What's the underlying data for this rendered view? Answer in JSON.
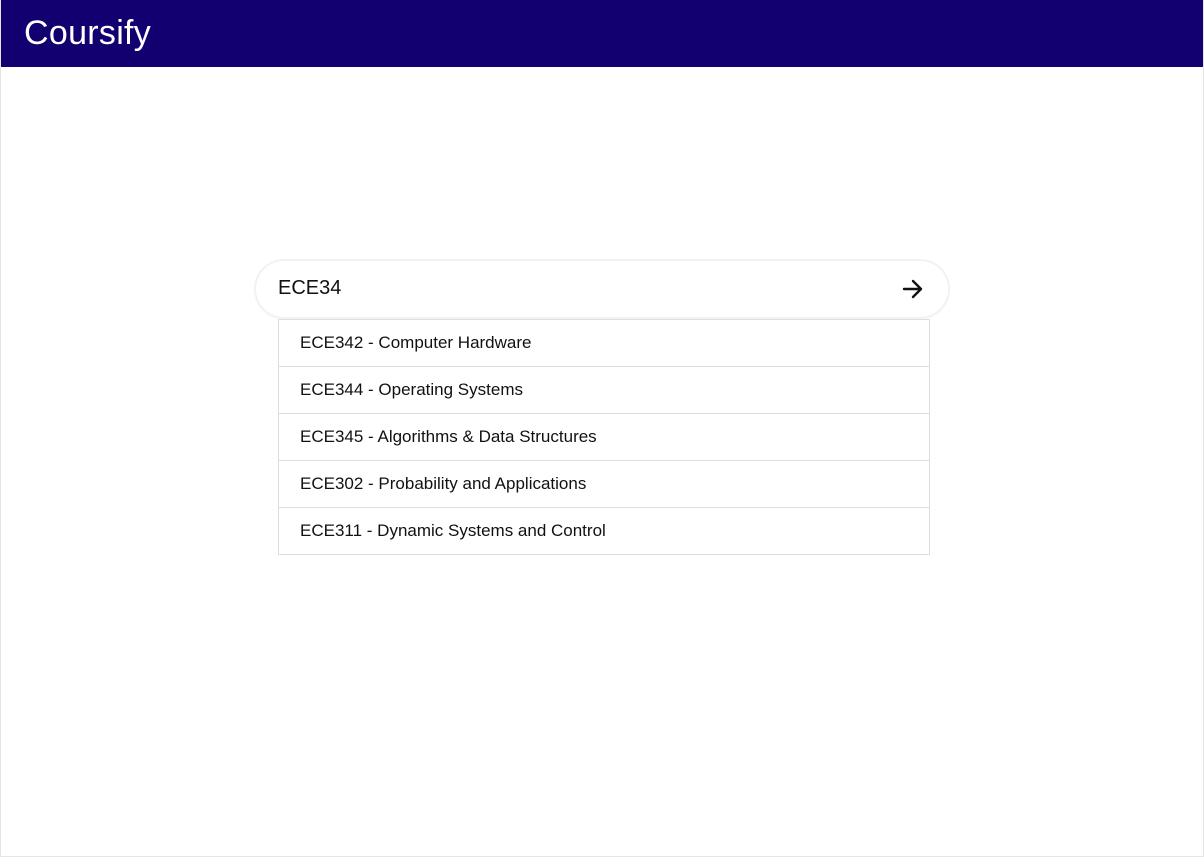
{
  "header": {
    "brand": "Coursify",
    "background": "#130070"
  },
  "search": {
    "value": "ECE34",
    "submit_icon": "arrow-right-icon"
  },
  "suggestions": [
    {
      "label": "ECE342 - Computer Hardware"
    },
    {
      "label": "ECE344 - Operating Systems"
    },
    {
      "label": "ECE345 - Algorithms & Data Structures"
    },
    {
      "label": "ECE302 - Probability and Applications"
    },
    {
      "label": "ECE311 - Dynamic Systems and Control"
    }
  ]
}
